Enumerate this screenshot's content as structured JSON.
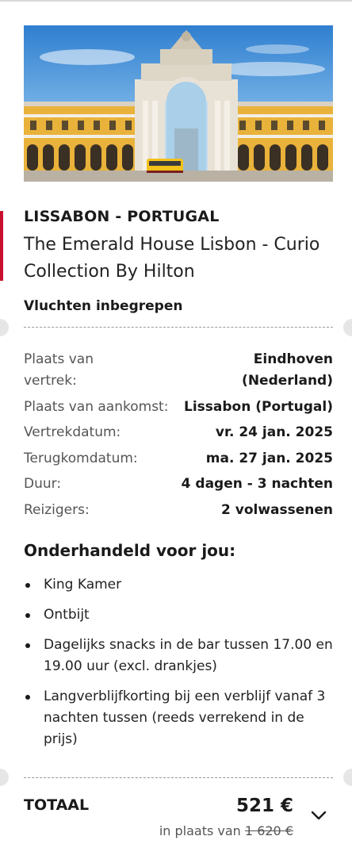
{
  "hero": {
    "image": "Triumphal arch and yellow tram at Praça do Comércio, Lisbon"
  },
  "destination": "LISSABON - PORTUGAL",
  "hotel_name": "The Emerald House Lisbon - Curio Collection By Hilton",
  "flights_included": "Vluchten inbegrepen",
  "details": [
    {
      "label": "Plaats van vertrek:",
      "value": "Eindhoven (Nederland)"
    },
    {
      "label": "Plaats van aankomst:",
      "value": "Lissabon (Portugal)"
    },
    {
      "label": "Vertrekdatum:",
      "value": "vr. 24 jan. 2025"
    },
    {
      "label": "Terugkomdatum:",
      "value": "ma. 27 jan. 2025"
    },
    {
      "label": "Duur:",
      "value": "4 dagen - 3 nachten"
    },
    {
      "label": "Reizigers:",
      "value": "2 volwassenen"
    }
  ],
  "included_title": "Onderhandeld voor jou:",
  "included": [
    "King Kamer",
    "Ontbijt",
    "Dagelijks snacks in de bar tussen 17.00 en 19.00 uur (excl. drankjes)",
    "Langverblijfkorting bij een verblijf vanaf 3 nachten tussen (reeds verrekend in de prijs)"
  ],
  "total": {
    "label": "TOTAAL",
    "price": "521 €",
    "compare_prefix": "in plaats van",
    "old_price": "1 620 €"
  },
  "icons": {
    "expand": "chevron-down-icon"
  },
  "colors": {
    "accent": "#c8102e",
    "notch": "#e6e6e6"
  }
}
